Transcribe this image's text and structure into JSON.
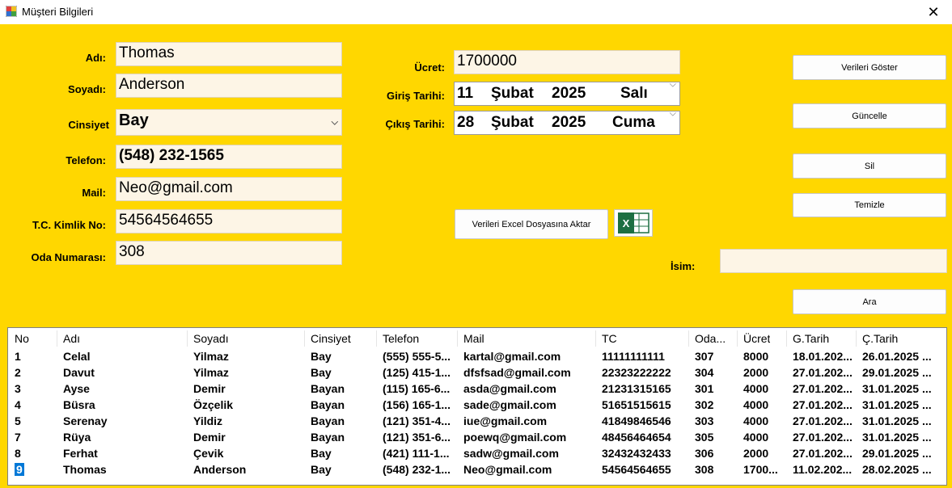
{
  "window": {
    "title": "Müşteri Bilgileri",
    "close": "✕"
  },
  "form": {
    "ad_label": "Adı:",
    "ad": "Thomas",
    "soyad_label": "Soyadı:",
    "soyad": "Anderson",
    "cinsiyet_label": "Cinsiyet",
    "cinsiyet": "Bay",
    "telefon_label": "Telefon:",
    "telefon": "(548) 232-1565",
    "mail_label": "Mail:",
    "mail": "Neo@gmail.com",
    "tc_label": "T.C. Kimlik No:",
    "tc": "54564564655",
    "oda_label": "Oda Numarası:",
    "oda": "308",
    "ucret_label": "Ücret:",
    "ucret": "1700000",
    "giris_label": "Giriş Tarihi:",
    "giris": {
      "day": "11",
      "month": "Şubat",
      "year": "2025",
      "weekday": "Salı"
    },
    "cikis_label": "Çıkış Tarihi:",
    "cikis": {
      "day": "28",
      "month": "Şubat",
      "year": "2025",
      "weekday": "Cuma"
    },
    "isim_label": "İsim:",
    "isim": ""
  },
  "buttons": {
    "goster": "Verileri Göster",
    "guncelle": "Güncelle",
    "sil": "Sil",
    "temizle": "Temizle",
    "ara": "Ara",
    "excel": "Verileri Excel Dosyasına Aktar"
  },
  "table": {
    "columns": [
      "No",
      "Adı",
      "Soyadı",
      "Cinsiyet",
      "Telefon",
      "Mail",
      "TC",
      "Oda...",
      "Ücret",
      "G.Tarih",
      "Ç.Tarih"
    ],
    "rows": [
      [
        "1",
        "Celal",
        "Yilmaz",
        "Bay",
        "(555) 555-5...",
        "kartal@gmail.com",
        "11111111111",
        "307",
        "8000",
        "18.01.202...",
        "26.01.2025 ..."
      ],
      [
        "2",
        "Davut",
        "Yilmaz",
        "Bay",
        "(125) 415-1...",
        "dfsfsad@gmail.com",
        "22323222222",
        "304",
        "2000",
        "27.01.202...",
        "29.01.2025 ..."
      ],
      [
        "3",
        "Ayse",
        "Demir",
        "Bayan",
        "(115) 165-6...",
        "asda@gmail.com",
        "21231315165",
        "301",
        "4000",
        "27.01.202...",
        "31.01.2025 ..."
      ],
      [
        "4",
        "Büsra",
        "Özçelik",
        "Bayan",
        "(156) 165-1...",
        "sade@gmail.com",
        "51651515615",
        "302",
        "4000",
        "27.01.202...",
        "31.01.2025 ..."
      ],
      [
        "5",
        "Serenay",
        "Yildiz",
        "Bayan",
        "(121) 351-4...",
        "iue@gmail.com",
        "41849846546",
        "303",
        "4000",
        "27.01.202...",
        "31.01.2025 ..."
      ],
      [
        "7",
        "Rüya",
        "Demir",
        "Bayan",
        "(121) 351-6...",
        "poewq@gmail.com",
        "48456464654",
        "305",
        "4000",
        "27.01.202...",
        "31.01.2025 ..."
      ],
      [
        "8",
        "Ferhat",
        "Çevik",
        "Bay",
        "(421) 111-1...",
        "sadw@gmail.com",
        "32432432433",
        "306",
        "2000",
        "27.01.202...",
        "29.01.2025 ..."
      ],
      [
        "9",
        "Thomas",
        "Anderson",
        "Bay",
        "(548) 232-1...",
        "Neo@gmail.com",
        "54564564655",
        "308",
        "1700...",
        "11.02.202...",
        "28.02.2025 ..."
      ]
    ]
  },
  "colors": {
    "background": "#ffd700",
    "field": "#fdf5e6",
    "selection": "#0078d7"
  },
  "icons": {
    "app": "app-icon",
    "excel": "excel-icon"
  }
}
